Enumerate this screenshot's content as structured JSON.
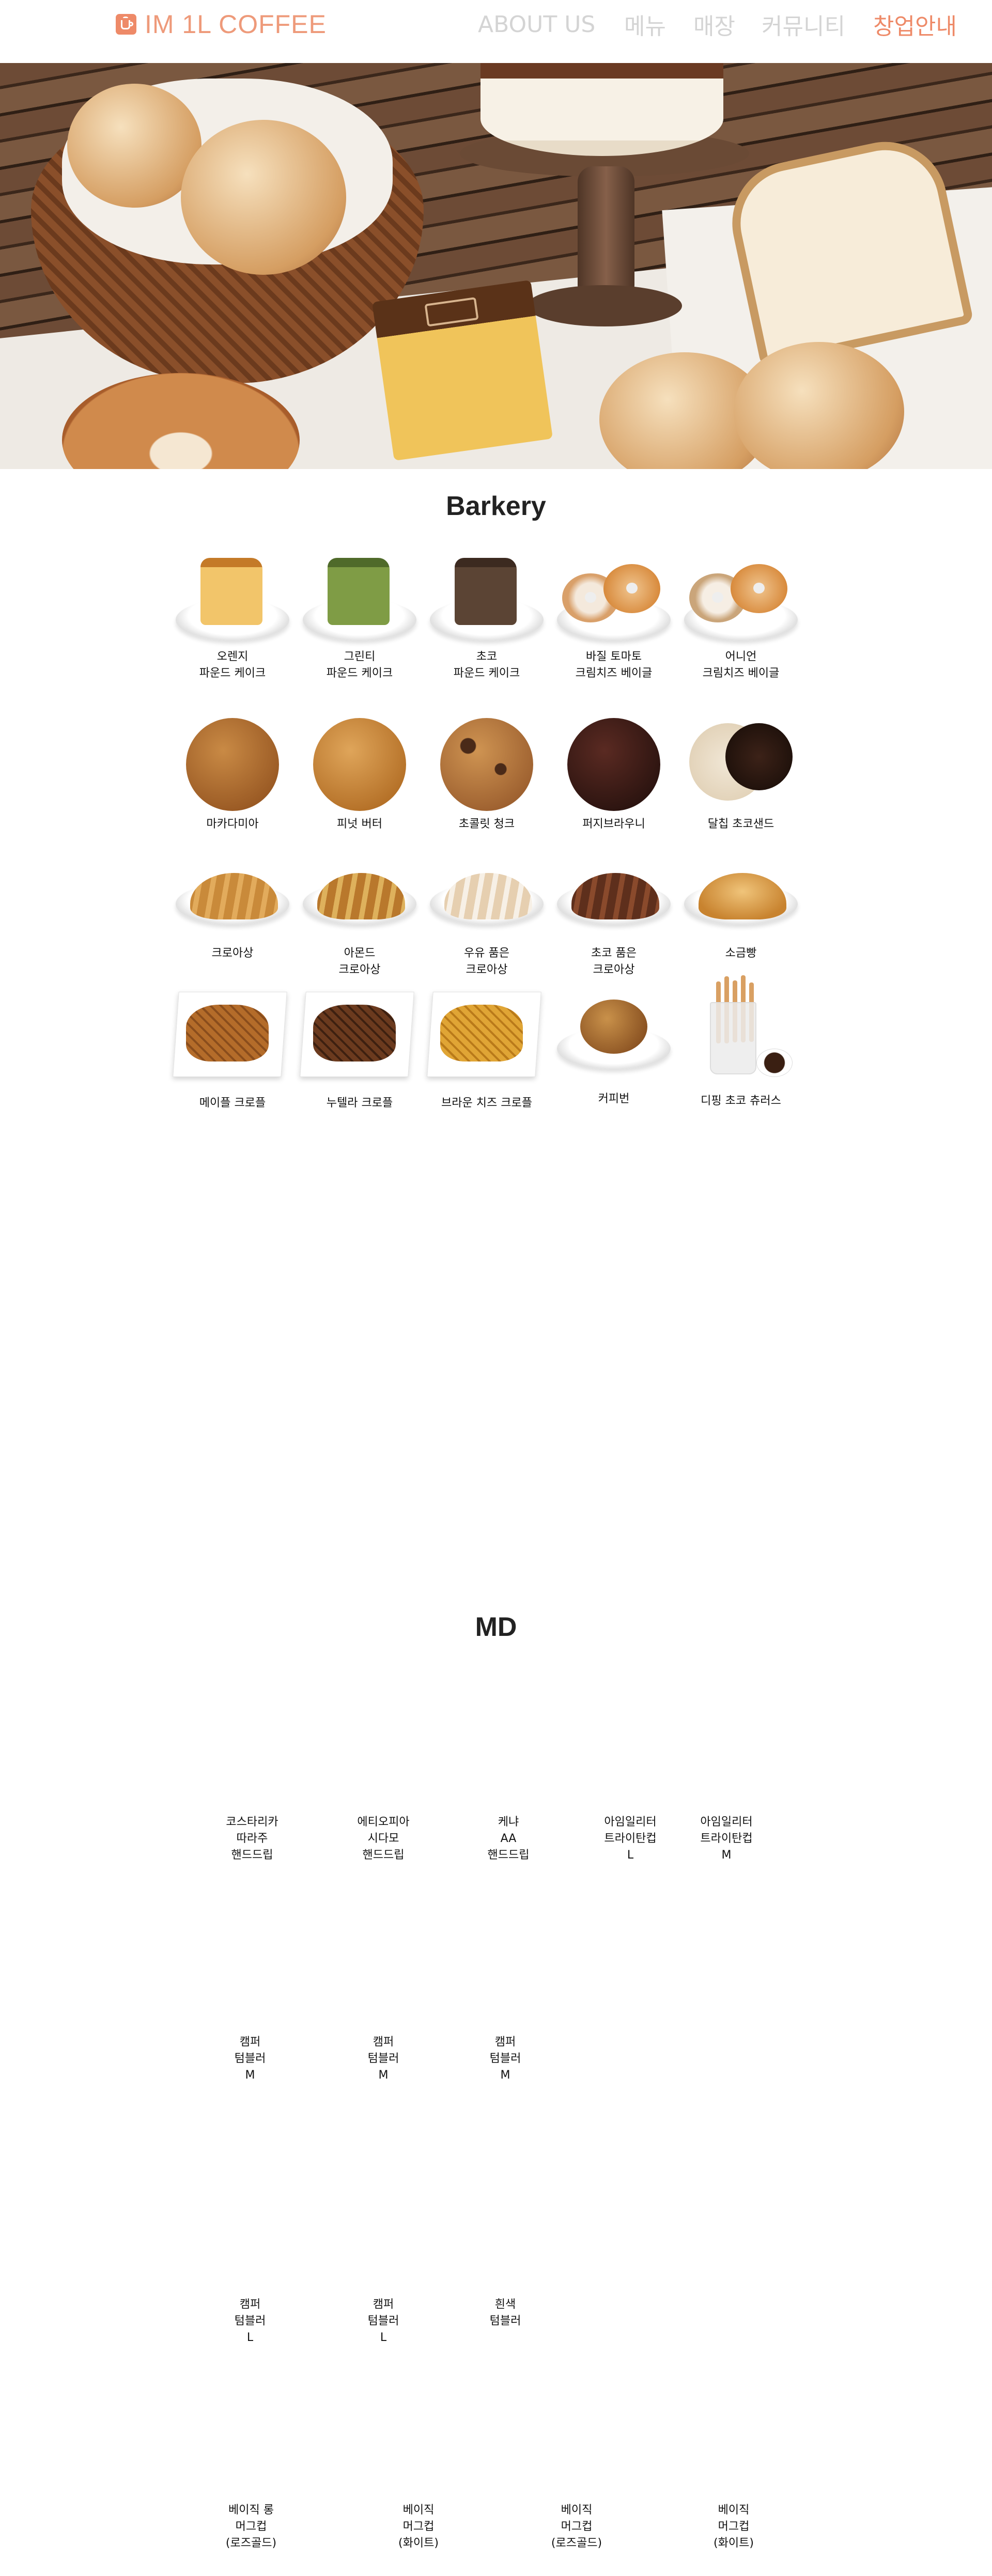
{
  "nav": {
    "brand": "IM 1L COFFEE",
    "items": [
      {
        "label": "ABOUT US",
        "active": false
      },
      {
        "label": "메뉴",
        "active": false
      },
      {
        "label": "매장",
        "active": false
      },
      {
        "label": "커뮤니티",
        "active": false
      },
      {
        "label": "창업안내",
        "active": true
      }
    ]
  },
  "bakery": {
    "title": "Barkery",
    "items": [
      "오렌지\n파운드 케이크",
      "그린티\n파운드 케이크",
      "초코\n파운드 케이크",
      "바질 토마토\n크림치즈 베이글",
      "어니언\n크림치즈 베이글",
      "마카다미아",
      "피넛 버터",
      "초콜릿 청크",
      "퍼지브라우니",
      "달칩 초코샌드",
      "크로아상",
      "아몬드\n크로아상",
      "우유 품은\n크로아상",
      "초코 품은\n크로아상",
      "소금빵",
      "메이플 크로플",
      "누텔라 크로플",
      "브라운 치즈 크로플",
      "커피번",
      "디핑 초코 츄러스"
    ]
  },
  "md": {
    "title": "MD",
    "items": [
      "코스타리카\n따라주\n핸드드립",
      "에티오피아\n시다모\n핸드드립",
      "케냐\nAA\n핸드드립",
      "아임일리터\n트라이탄컵\nL",
      "아임일리터\n트라이탄컵\nM",
      "캠퍼\n텀블러\nM",
      "캠퍼\n텀블러\nM",
      "캠퍼\n텀블러\nM",
      "캠퍼\n텀블러\nL",
      "캠퍼\n텀블러\nL",
      "흰색\n텀블러",
      "베이직 롱\n머그컵\n(로즈골드)",
      "베이직\n머그컵\n(화이트)",
      "베이직\n머그컵\n(로즈골드)",
      "베이직\n머그컵\n(화이트)"
    ]
  },
  "colors": {
    "accent": "#ee8a68",
    "nav_inactive": "#d4d4d4"
  }
}
